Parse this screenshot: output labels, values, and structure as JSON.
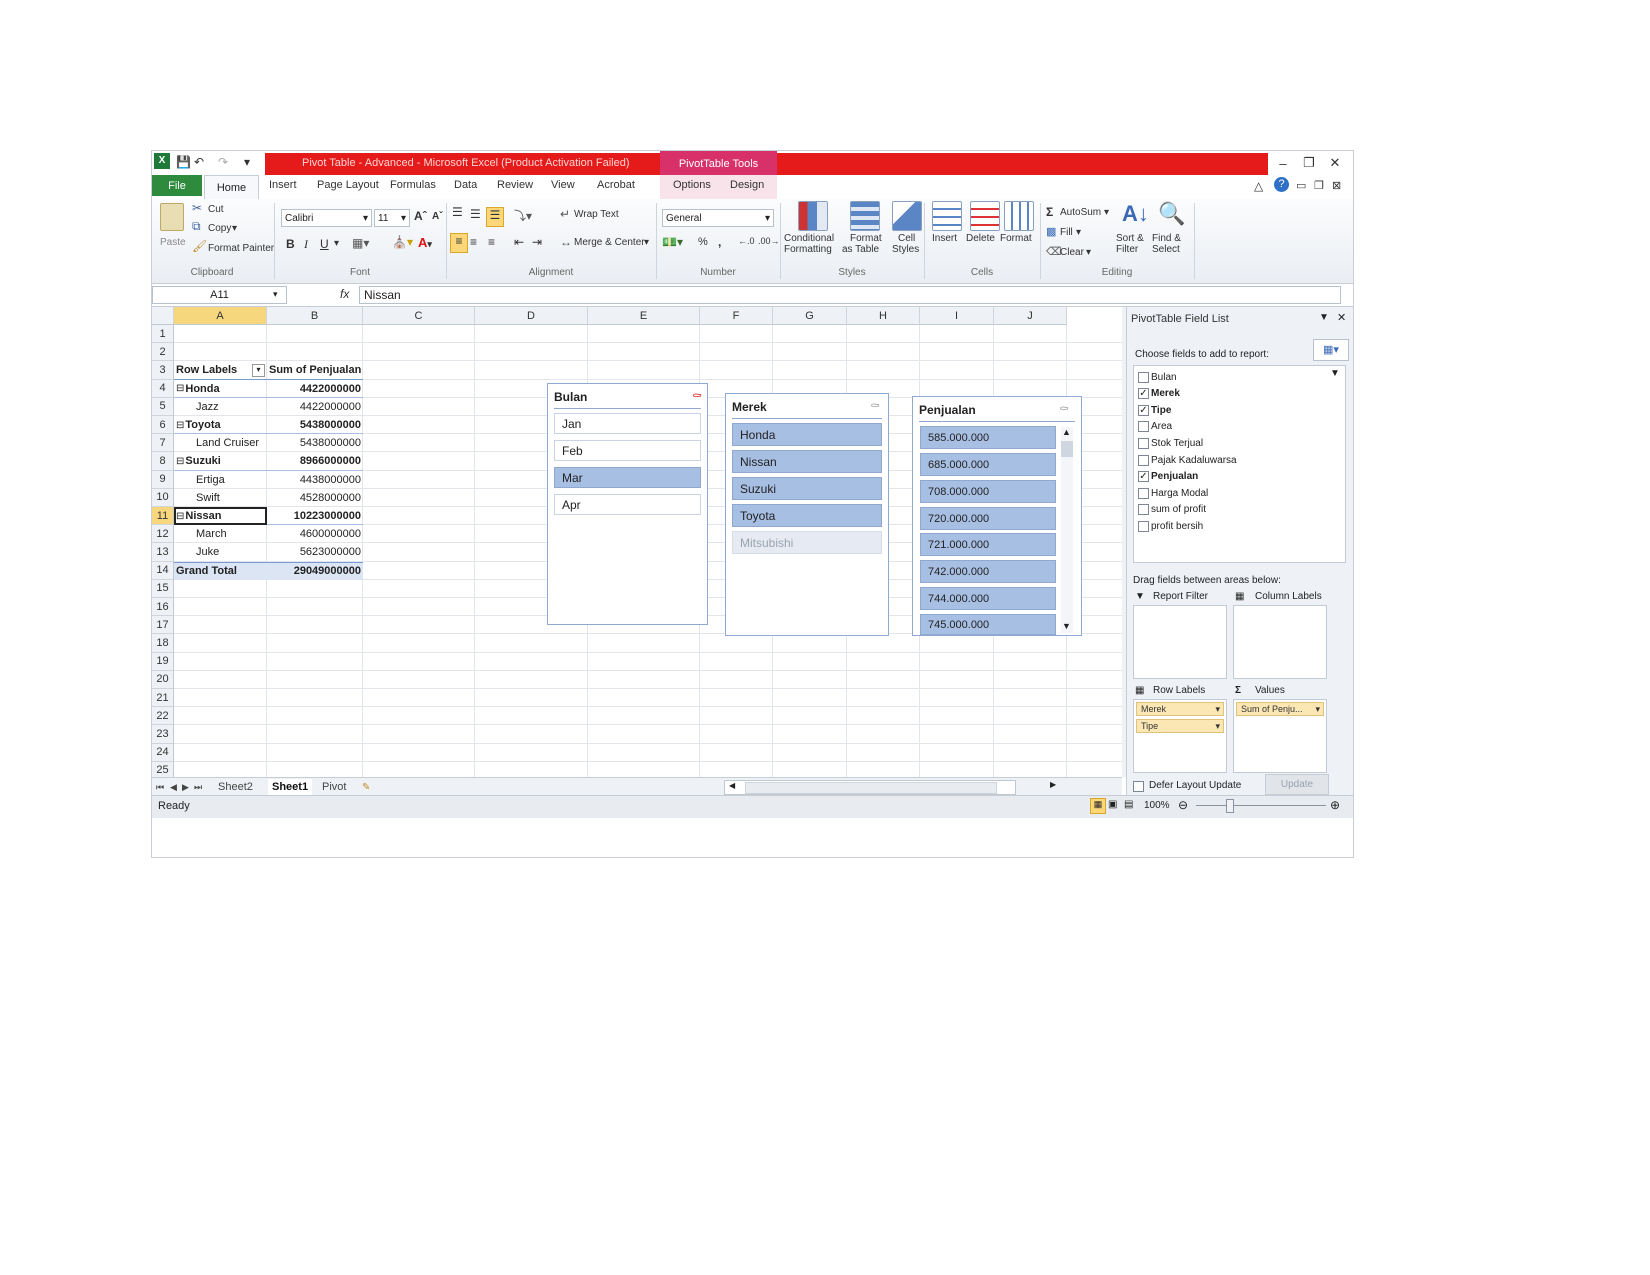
{
  "window": {
    "title": "Pivot Table - Advanced  -  Microsoft Excel (Product Activation Failed)",
    "context_tab": "PivotTable Tools"
  },
  "tabs": [
    "File",
    "Home",
    "Insert",
    "Page Layout",
    "Formulas",
    "Data",
    "Review",
    "View",
    "Acrobat",
    "Options",
    "Design"
  ],
  "ribbon": {
    "clipboard": {
      "paste": "Paste",
      "cut": "Cut",
      "copy": "Copy",
      "format_painter": "Format Painter",
      "label": "Clipboard"
    },
    "font": {
      "name": "Calibri",
      "size": "11",
      "label": "Font"
    },
    "alignment": {
      "wrap": "Wrap Text",
      "merge": "Merge & Center",
      "label": "Alignment"
    },
    "number": {
      "format": "General",
      "label": "Number",
      "percent": "%",
      "comma": ","
    },
    "styles": {
      "conditional": "Conditional",
      "conditional2": "Formatting",
      "format_table": "Format",
      "format_table2": "as Table",
      "cell_styles": "Cell",
      "cell_styles2": "Styles",
      "label": "Styles"
    },
    "cells": {
      "insert": "Insert",
      "delete": "Delete",
      "format": "Format",
      "label": "Cells"
    },
    "editing": {
      "autosum": "AutoSum",
      "fill": "Fill",
      "clear": "Clear",
      "sort": "Sort &",
      "sort2": "Filter",
      "find": "Find &",
      "find2": "Select",
      "label": "Editing"
    }
  },
  "formula_bar": {
    "name_box": "A11",
    "fx": "fx",
    "value": "Nissan"
  },
  "columns": [
    "A",
    "B",
    "C",
    "D",
    "E",
    "F",
    "G",
    "H",
    "I",
    "J"
  ],
  "rows": [
    "1",
    "2",
    "3",
    "4",
    "5",
    "6",
    "7",
    "8",
    "9",
    "10",
    "11",
    "12",
    "13",
    "14",
    "15",
    "16",
    "17",
    "18",
    "19",
    "20",
    "21",
    "22",
    "23",
    "24",
    "25"
  ],
  "pivot": {
    "header_a": "Row Labels",
    "header_b": "Sum of Penjualan",
    "rows": [
      {
        "label": "Honda",
        "value": "4422000000",
        "group": true
      },
      {
        "label": "Jazz",
        "value": "4422000000",
        "group": false
      },
      {
        "label": "Toyota",
        "value": "5438000000",
        "group": true
      },
      {
        "label": "Land Cruiser",
        "value": "5438000000",
        "group": false
      },
      {
        "label": "Suzuki",
        "value": "8966000000",
        "group": true
      },
      {
        "label": "Ertiga",
        "value": "4438000000",
        "group": false
      },
      {
        "label": "Swift",
        "value": "4528000000",
        "group": false
      },
      {
        "label": "Nissan",
        "value": "10223000000",
        "group": true
      },
      {
        "label": "March",
        "value": "4600000000",
        "group": false
      },
      {
        "label": "Juke",
        "value": "5623000000",
        "group": false
      }
    ],
    "grand_total_label": "Grand Total",
    "grand_total_value": "29049000000"
  },
  "slicers": {
    "bulan": {
      "title": "Bulan",
      "items": [
        "Jan",
        "Feb",
        "Mar",
        "Apr"
      ],
      "selected": [
        "Mar"
      ]
    },
    "merek": {
      "title": "Merek",
      "items": [
        "Honda",
        "Nissan",
        "Suzuki",
        "Toyota",
        "Mitsubishi"
      ],
      "selected": [
        "Honda",
        "Nissan",
        "Suzuki",
        "Toyota"
      ],
      "dimmed": [
        "Mitsubishi"
      ]
    },
    "penjualan": {
      "title": "Penjualan",
      "items": [
        "585.000.000",
        "685.000.000",
        "708.000.000",
        "720.000.000",
        "721.000.000",
        "742.000.000",
        "744.000.000",
        "745.000.000"
      ]
    }
  },
  "sheets": [
    "Sheet2",
    "Sheet1",
    "Pivot"
  ],
  "active_sheet": "Sheet1",
  "status": {
    "ready": "Ready",
    "zoom": "100%"
  },
  "field_list": {
    "title": "PivotTable Field List",
    "choose": "Choose fields to add to report:",
    "fields": [
      {
        "name": "Bulan",
        "checked": false
      },
      {
        "name": "Merek",
        "checked": true
      },
      {
        "name": "Tipe",
        "checked": true
      },
      {
        "name": "Area",
        "checked": false
      },
      {
        "name": "Stok Terjual",
        "checked": false
      },
      {
        "name": "Pajak Kadaluwarsa",
        "checked": false
      },
      {
        "name": "Penjualan",
        "checked": true
      },
      {
        "name": "Harga Modal",
        "checked": false
      },
      {
        "name": "sum of profit",
        "checked": false
      },
      {
        "name": "profit bersih",
        "checked": false
      }
    ],
    "drag_text": "Drag fields between areas below:",
    "report_filter": "Report Filter",
    "column_labels": "Column Labels",
    "row_labels": "Row Labels",
    "values": "Values",
    "row_items": [
      "Merek",
      "Tipe"
    ],
    "value_items": [
      "Sum of Penju..."
    ],
    "defer": "Defer Layout Update",
    "update": "Update"
  }
}
